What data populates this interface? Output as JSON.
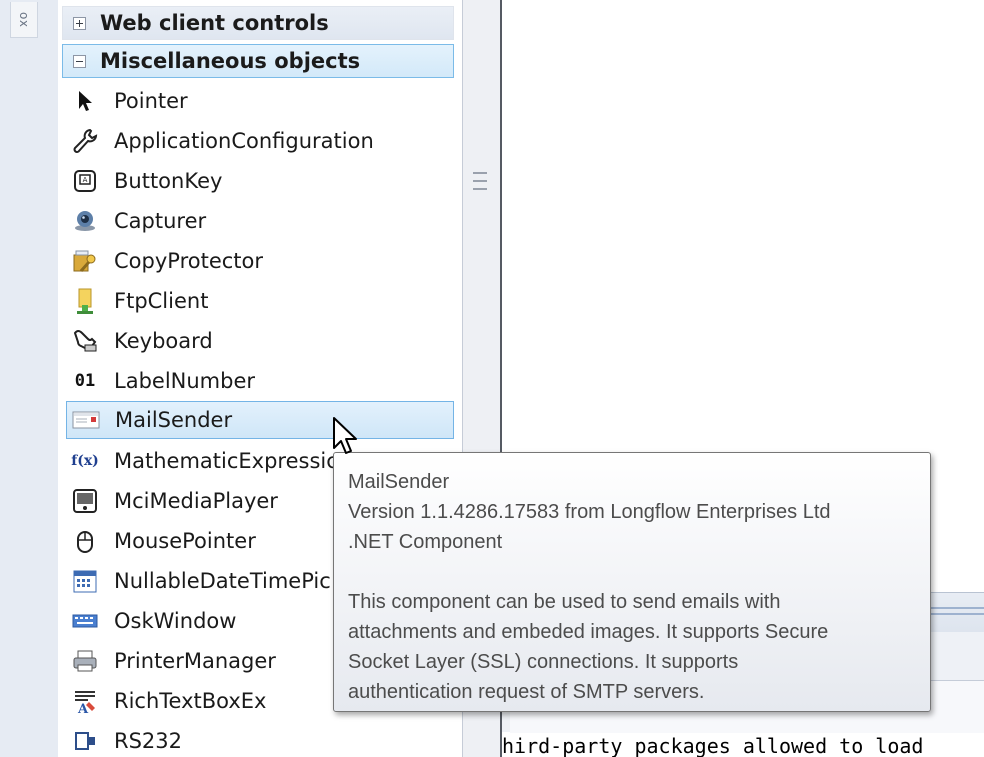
{
  "left_tab": {
    "label": "ox"
  },
  "toolbox": {
    "groups": [
      {
        "label": "Web client controls",
        "state": "collapsed"
      },
      {
        "label": "Miscellaneous objects",
        "state": "expanded"
      }
    ],
    "items": [
      {
        "label": "Pointer",
        "icon": "pointer-arrow-icon"
      },
      {
        "label": "ApplicationConfiguration",
        "icon": "wrench-icon"
      },
      {
        "label": "ButtonKey",
        "icon": "key-button-icon"
      },
      {
        "label": "Capturer",
        "icon": "webcam-icon"
      },
      {
        "label": "CopyProtector",
        "icon": "lock-key-icon"
      },
      {
        "label": "FtpClient",
        "icon": "ftp-folder-icon"
      },
      {
        "label": "Keyboard",
        "icon": "hand-keyboard-icon"
      },
      {
        "label": "LabelNumber",
        "icon": "number-01-icon",
        "glyph": "01"
      },
      {
        "label": "MailSender",
        "icon": "mail-envelope-icon",
        "selected": true
      },
      {
        "label": "MathematicExpressic",
        "icon": "fx-function-icon",
        "glyph": "f(x)"
      },
      {
        "label": "MciMediaPlayer",
        "icon": "media-player-icon"
      },
      {
        "label": "MousePointer",
        "icon": "mouse-icon"
      },
      {
        "label": "NullableDateTimePic",
        "icon": "calendar-icon"
      },
      {
        "label": "OskWindow",
        "icon": "onscreen-keyboard-icon"
      },
      {
        "label": "PrinterManager",
        "icon": "printer-icon"
      },
      {
        "label": "RichTextBoxEx",
        "icon": "rich-text-icon"
      },
      {
        "label": "RS232",
        "icon": "serial-port-icon"
      }
    ]
  },
  "tooltip": {
    "title": "MailSender",
    "version": "Version 1.1.4286.17583 from Longflow Enterprises Ltd",
    "kind": ".NET Component",
    "description": [
      "This component can be used to send emails with",
      "attachments and embeded images. It supports Secure",
      "Socket Layer (SSL) connections. It supports",
      "authentication request of SMTP servers."
    ]
  },
  "code_panel": {
    "line": "hird-party packages allowed to load"
  },
  "colors": {
    "selection_border": "#74b4e6",
    "selection_fill": "#d8ebfa",
    "tooltip_border": "#767676"
  }
}
